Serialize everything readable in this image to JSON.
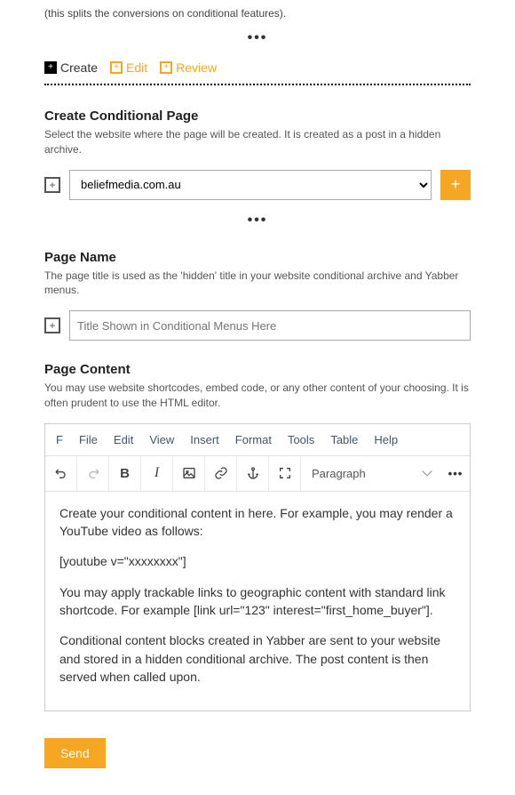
{
  "intro": "(this splits the conversions on conditional features).",
  "tabs": {
    "create": "Create",
    "edit": "Edit",
    "review": "Review"
  },
  "sec1": {
    "title": "Create Conditional Page",
    "desc": "Select the website where the page will be created. It is created as a post in a hidden archive.",
    "selected": "beliefmedia.com.au"
  },
  "sec2": {
    "title": "Page Name",
    "desc": "The page title is used as the 'hidden' title in your website conditional archive and Yabber menus.",
    "placeholder": "Title Shown in Conditional Menus Here"
  },
  "sec3": {
    "title": "Page Content",
    "desc": "You may use website shortcodes, embed code, or any other content of your choosing. It is often prudent to use the HTML editor."
  },
  "menubar": {
    "f": "F",
    "file": "File",
    "edit": "Edit",
    "view": "View",
    "insert": "Insert",
    "format": "Format",
    "tools": "Tools",
    "table": "Table",
    "help": "Help"
  },
  "toolbar": {
    "paragraph": "Paragraph"
  },
  "editor_body": {
    "p1": "Create your conditional content in here. For example, you may render a YouTube video as follows:",
    "p2": "[youtube v=\"xxxxxxxx\"]",
    "p3": "You may apply trackable links to geographic content with standard link shortcode. For example [link url=\"123\" interest=\"first_home_buyer\"].",
    "p4": "Conditional content blocks created in Yabber are sent to your website and stored in a hidden conditional archive. The post content is then served when called upon."
  },
  "buttons": {
    "send": "Send"
  }
}
